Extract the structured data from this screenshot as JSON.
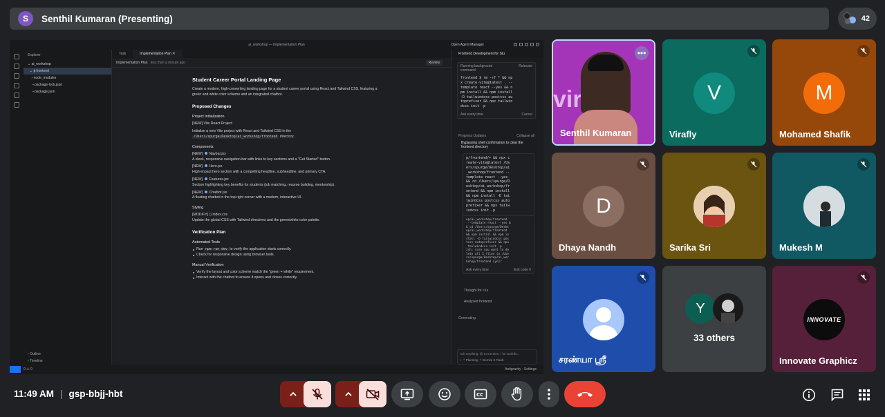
{
  "presenter": {
    "avatar_letter": "S",
    "label": "Senthil Kumaran (Presenting)"
  },
  "participant_count": "42",
  "screen": {
    "window_title": "ai_workshop — Implementation Plan",
    "agent_manager": "Open Agent Manager",
    "explorer": {
      "header": "Explorer",
      "root": "ai_workshop",
      "items": [
        "frontend",
        "node_modules",
        "package-lock.json",
        "package.json"
      ],
      "outline": "Outline",
      "timeline": "Timeline"
    },
    "tabs": [
      "Task",
      "Implementation Plan"
    ],
    "crumb": {
      "title": "Implementation Plan",
      "time": "less than a minute ago",
      "review": "Review"
    },
    "doc": {
      "title": "Student Career Portal Landing Page",
      "intro": "Create a modern, high-converting landing page for a student career portal using React and Tailwind CSS, featuring a green and white color scheme and an integrated chatbot.",
      "proposed": "Proposed Changes",
      "proj_init": "Project Initialization",
      "vite_tag": "[NEW] Vite React Project",
      "vite_desc": "Initialize a new Vite project with React and Tailwind CSS in the",
      "vite_path": "/Users/spurge/Desktop/ai_workshop/frontend",
      "vite_end": "directory.",
      "components": "Components",
      "navbar_tag": "[NEW]",
      "navbar_file": "Navbar.jsx",
      "navbar_desc": "A sleek, responsive navigation bar with links to key sections and a \"Get Started\" button.",
      "hero_tag": "[NEW]",
      "hero_file": "Hero.jsx",
      "hero_desc": "High-impact hero section with a compelling headline, subheadline, and primary CTA.",
      "features_tag": "[NEW]",
      "features_file": "Features.jsx",
      "features_desc": "Section highlighting key benefits for students (job matching, resume building, mentorship).",
      "chatbot_tag": "[NEW]",
      "chatbot_file": "Chatbot.jsx",
      "chatbot_desc": "A floating chatbot in the top right corner with a modern, interactive UI.",
      "styling": "Styling",
      "css_tag": "[MODIFY]",
      "css_file": "index.css",
      "css_desc": "Update the global CSS with Tailwind directives and the green/white color palette.",
      "verification": "Verification Plan",
      "auto_tests": "Automated Tests",
      "auto_1a": "Run",
      "auto_1code": "npm run dev",
      "auto_1b": "to verify the application starts correctly.",
      "auto_2": "Check for responsive design using browser tools.",
      "manual": "Manual Verification",
      "manual_1": "Verify the layout and color scheme match the \"green + white\" requirement.",
      "manual_2": "Interact with the chatbot to ensure it opens and closes correctly."
    },
    "agent": {
      "title": "Frontend Development for Stu",
      "running": "Running background command",
      "relocate": "Relocate",
      "cmd1": "frontend $ rm -rf * && np\nx create-vite@latest . --\ntemplate react --yes && n\npm install && npm install\n-D tailwindcss postcss au\ntoprefixer && npx tailwin\ndcss init -p",
      "ask": "Ask every time",
      "cancel": "Cancel",
      "progress": "Progress Updates",
      "collapse": "Collapse all",
      "step": "Bypassing shell confirmation to clear the frontend directory",
      "cmd2": "p/frontend/+ && npx c\nreate-vite@latest /Us\ners/spurge/Desktop/ai\n_workshop/frontend --\ntemplate react --yes\n&& cd /Users/spurge/D\nesktop/ai_workshop/fr\nontend && npm install\n&& npm install -D tai\nlwindcss postcss auto\nprefixer && npx tailw\nindcss init -p",
      "cmd3": "op/ai_workshop/frontend\n --template react --yes &\n& cd /Users/spurge/Deskt\nop/ai_workshop/frontend\n&& npm install && npm in\nstall -D tailwindcss pos\ntcss autoprefixer && npx\n tailwindcss init -p\nzsh: sure you want to de\nlete all 3 files in /Use\nrs/spurge/Desktop/ai_wor\nkshop/frontend [yn]?",
      "ask2": "Ask every time",
      "exit": "Exit code 0",
      "thought": "Thought for <1s",
      "analyzed": "Analyzed frontend",
      "generating": "Generating.",
      "input_ph": "Ask anything, @ to mention, / for workflo...",
      "planning": "Planning",
      "model": "Gemini 3 Flash"
    },
    "status": {
      "left": "0 ⚠ 0",
      "right": "Antigravity - Settings"
    }
  },
  "tiles": [
    {
      "name": "Senthil Kumaran",
      "bg": "#9a3da8",
      "video": true
    },
    {
      "name": "Virafly",
      "bg": "#0b6f63",
      "letter": "V",
      "avatar_bg": "#0d8a7c"
    },
    {
      "name": "Mohamed Shafik",
      "bg": "#9d4d08",
      "letter": "M",
      "avatar_bg": "#f06d0a"
    },
    {
      "name": "Dhaya Nandh",
      "bg": "#6b4d40",
      "letter": "D",
      "avatar_bg": "#8d6e63"
    },
    {
      "name": "Sarika Sri",
      "bg": "#6d5410",
      "photo": true
    },
    {
      "name": "Mukesh M",
      "bg": "#115a62",
      "photo": true
    },
    {
      "name": "சரண்யா ஸ்ரீ",
      "bg": "#1e4fae",
      "generic": true
    },
    {
      "name": "33 others",
      "bg": "#3c4043",
      "letter": "Y"
    },
    {
      "name": "Innovate Graphicz",
      "bg": "#5a1d33",
      "logo": "INNOVATE"
    }
  ],
  "meeting": {
    "time": "11:49 AM",
    "code": "gsp-bbjj-hbt"
  },
  "colors": {
    "accent_red": "#ea4335",
    "muted_bg": "#f9dedc",
    "tile_grey": "#3c4043"
  }
}
